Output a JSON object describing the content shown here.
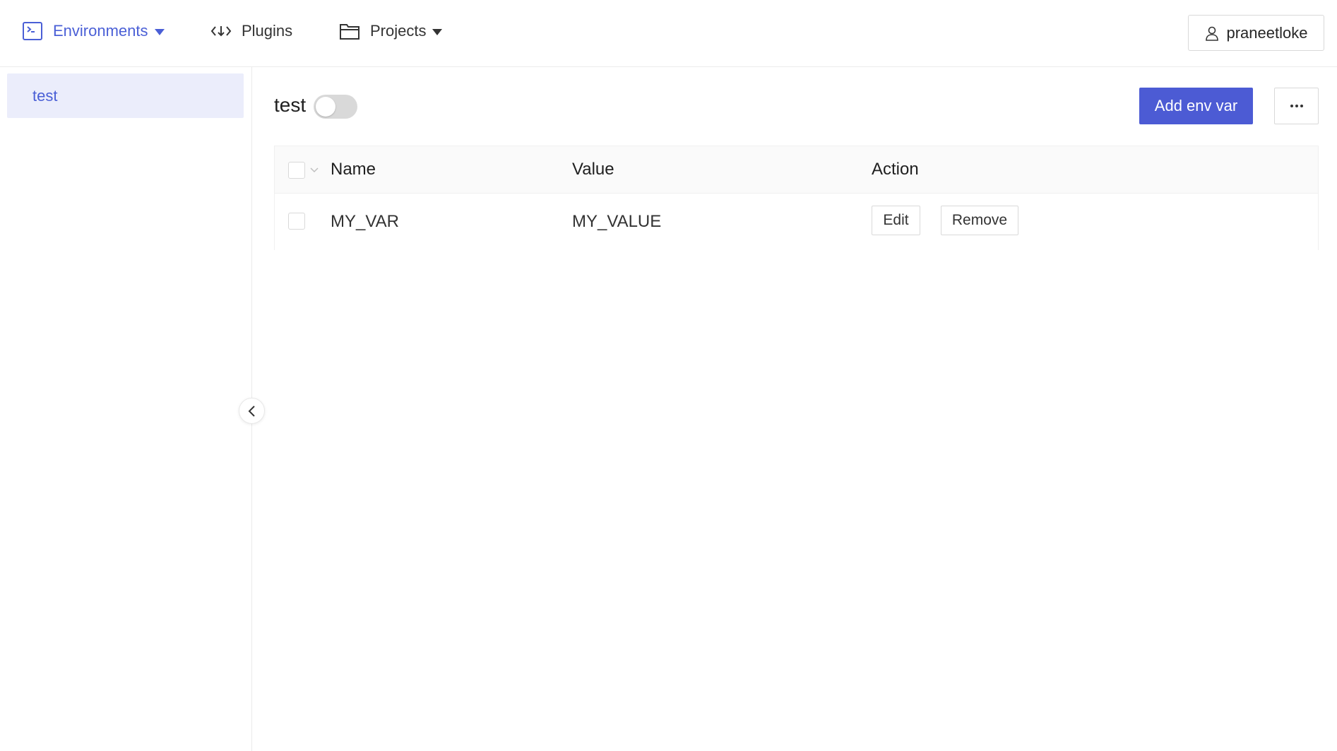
{
  "nav": {
    "environments": "Environments",
    "plugins": "Plugins",
    "projects": "Projects",
    "active_color": "#4a5fd6"
  },
  "user": {
    "name": "praneetloke"
  },
  "sidebar": {
    "items": [
      {
        "label": "test",
        "selected": true
      }
    ]
  },
  "main": {
    "env_name": "test",
    "enabled": false,
    "add_button": "Add env var",
    "table": {
      "columns": [
        "Name",
        "Value",
        "Action"
      ],
      "rows": [
        {
          "name": "MY_VAR",
          "value": "MY_VALUE",
          "edit": "Edit",
          "remove": "Remove"
        }
      ]
    }
  },
  "colors": {
    "primary": "#4c5bd4",
    "selected_bg": "#ebedfb"
  }
}
